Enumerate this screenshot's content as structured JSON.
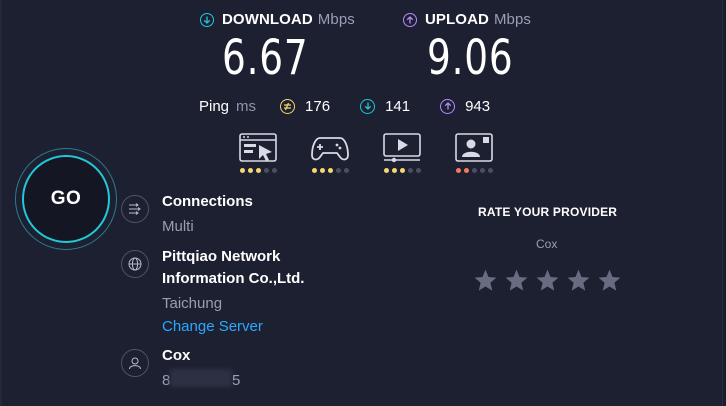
{
  "download": {
    "label": "DOWNLOAD",
    "unit": "Mbps",
    "value": "6.67"
  },
  "upload": {
    "label": "UPLOAD",
    "unit": "Mbps",
    "value": "9.06"
  },
  "ping": {
    "label": "Ping",
    "unit": "ms",
    "idle": "176",
    "download": "141",
    "upload": "943"
  },
  "activities": [
    {
      "icon": "web-browsing-icon",
      "rating": 3,
      "color": "yellow"
    },
    {
      "icon": "gaming-icon",
      "rating": 3,
      "color": "yellow"
    },
    {
      "icon": "video-streaming-icon",
      "rating": 3,
      "color": "yellow"
    },
    {
      "icon": "video-chat-icon",
      "rating": 2,
      "color": "red"
    }
  ],
  "go": {
    "label": "GO"
  },
  "connections": {
    "title": "Connections",
    "value": "Multi"
  },
  "server": {
    "name_line1": "Pittqiao Network",
    "name_line2": "Information Co.,Ltd.",
    "location": "Taichung",
    "change_label": "Change Server"
  },
  "provider": {
    "name": "Cox",
    "ip_start": "8",
    "ip_end": "5"
  },
  "rating": {
    "title": "RATE YOUR PROVIDER",
    "isp": "Cox",
    "stars": 5
  },
  "colors": {
    "accent_teal": "#20c8d8",
    "upload_purple": "#b78aff",
    "idle_yellow": "#f5d76e",
    "link_blue": "#2aa8ff",
    "background": "#1d2031"
  }
}
